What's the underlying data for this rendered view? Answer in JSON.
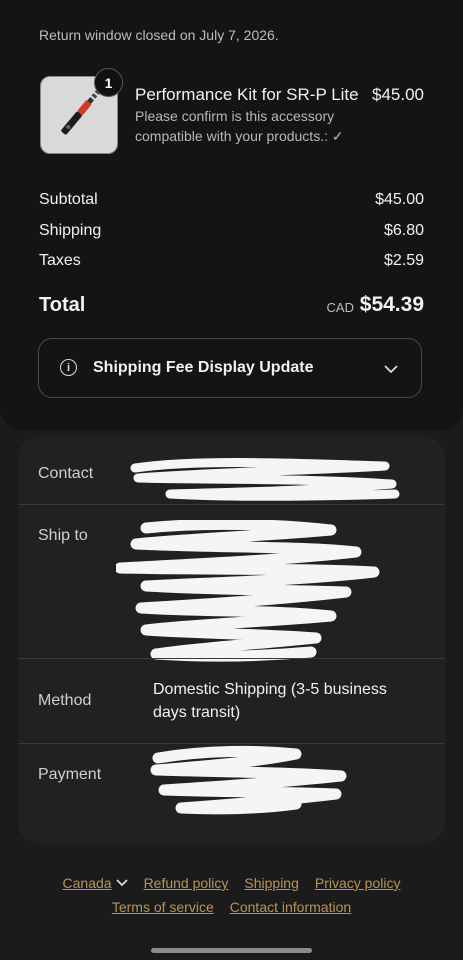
{
  "return_notice": "Return window closed on July 7, 2026.",
  "product": {
    "quantity": "1",
    "name": "Performance Kit for SR-P Lite",
    "price": "$45.00",
    "note": "Please confirm is this accessory compatible with your products.: ✓"
  },
  "summary": {
    "subtotal_label": "Subtotal",
    "subtotal_value": "$45.00",
    "shipping_label": "Shipping",
    "shipping_value": "$6.80",
    "taxes_label": "Taxes",
    "taxes_value": "$2.59",
    "total_label": "Total",
    "total_currency": "CAD",
    "total_value": "$54.39"
  },
  "fee_notice": {
    "title": "Shipping Fee Display Update"
  },
  "details": {
    "contact_label": "Contact",
    "ship_to_label": "Ship to",
    "method_label": "Method",
    "method_value": "Domestic Shipping (3-5 business days transit)",
    "payment_label": "Payment"
  },
  "footer": {
    "country": "Canada",
    "refund": "Refund policy",
    "shipping": "Shipping",
    "privacy": "Privacy policy",
    "terms": "Terms of service",
    "contact": "Contact information"
  },
  "colors": {
    "background": "#1b1b1b",
    "card": "#212121",
    "link": "#b8945a"
  },
  "icons": [
    "info-icon",
    "chevron-down-icon",
    "product-image"
  ]
}
